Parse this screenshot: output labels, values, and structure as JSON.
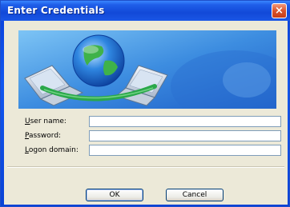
{
  "window": {
    "title": "Enter Credentials",
    "close_glyph": "×"
  },
  "banner": {
    "icon": "network-globe-icon"
  },
  "form": {
    "username_label": "User name:",
    "password_label": "Password:",
    "domain_label": "Logon domain:",
    "username_value": "",
    "password_value": "",
    "domain_value": ""
  },
  "buttons": {
    "ok_label": "OK",
    "cancel_label": "Cancel"
  },
  "colors": {
    "titlebar": "#1249d8",
    "client": "#ece9d8",
    "banner_bg": "#5aa7e6"
  }
}
